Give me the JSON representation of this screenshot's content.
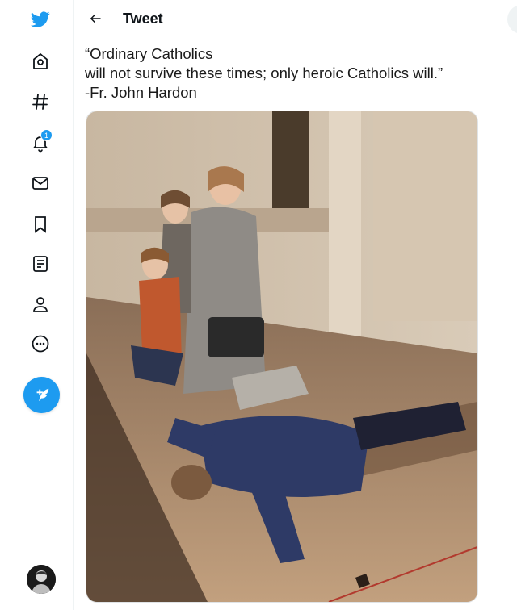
{
  "sidebar": {
    "notification_count": "1",
    "items": [
      {
        "name": "twitter-logo-icon"
      },
      {
        "name": "home-icon"
      },
      {
        "name": "explore-hashtag-icon"
      },
      {
        "name": "notifications-bell-icon"
      },
      {
        "name": "messages-envelope-icon"
      },
      {
        "name": "bookmarks-icon"
      },
      {
        "name": "lists-icon"
      },
      {
        "name": "profile-icon"
      },
      {
        "name": "more-icon"
      }
    ]
  },
  "header": {
    "title": "Tweet"
  },
  "tweet": {
    "lines": [
      "“Ordinary Catholics",
      "will not survive these times; only heroic Catholics will.”",
      "-Fr. John Hardon"
    ]
  },
  "colors": {
    "brand": "#1d9bf0",
    "text": "#0f1419"
  }
}
